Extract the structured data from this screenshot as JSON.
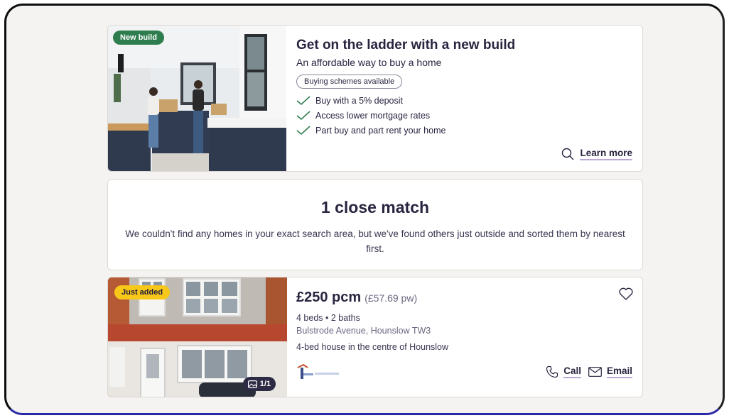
{
  "promo": {
    "badge": "New build",
    "title": "Get on the ladder with a new build",
    "subtitle": "An affordable way to buy a home",
    "pill": "Buying schemes available",
    "features": [
      "Buy with a 5% deposit",
      "Access lower mortgage rates",
      "Part buy and part rent your home"
    ],
    "learn_more": "Learn more"
  },
  "match": {
    "title": "1 close match",
    "text": "We couldn't find any homes in your exact search area, but we've found others just outside and sorted them by nearest first."
  },
  "listing": {
    "badge": "Just added",
    "price": "£250 pcm",
    "price_pw": "(£57.69 pw)",
    "beds_baths": "4 beds • 2 baths",
    "address": "Bulstrode Avenue, Hounslow TW3",
    "description": "4-bed house in the centre of Hounslow",
    "image_count": "1/1",
    "call_label": "Call",
    "email_label": "Email"
  },
  "colors": {
    "new_build_badge": "#2e7d4f",
    "just_added_badge": "#f7c719",
    "link_underline": "#b9a7d6",
    "tick": "#2e7d4f"
  }
}
